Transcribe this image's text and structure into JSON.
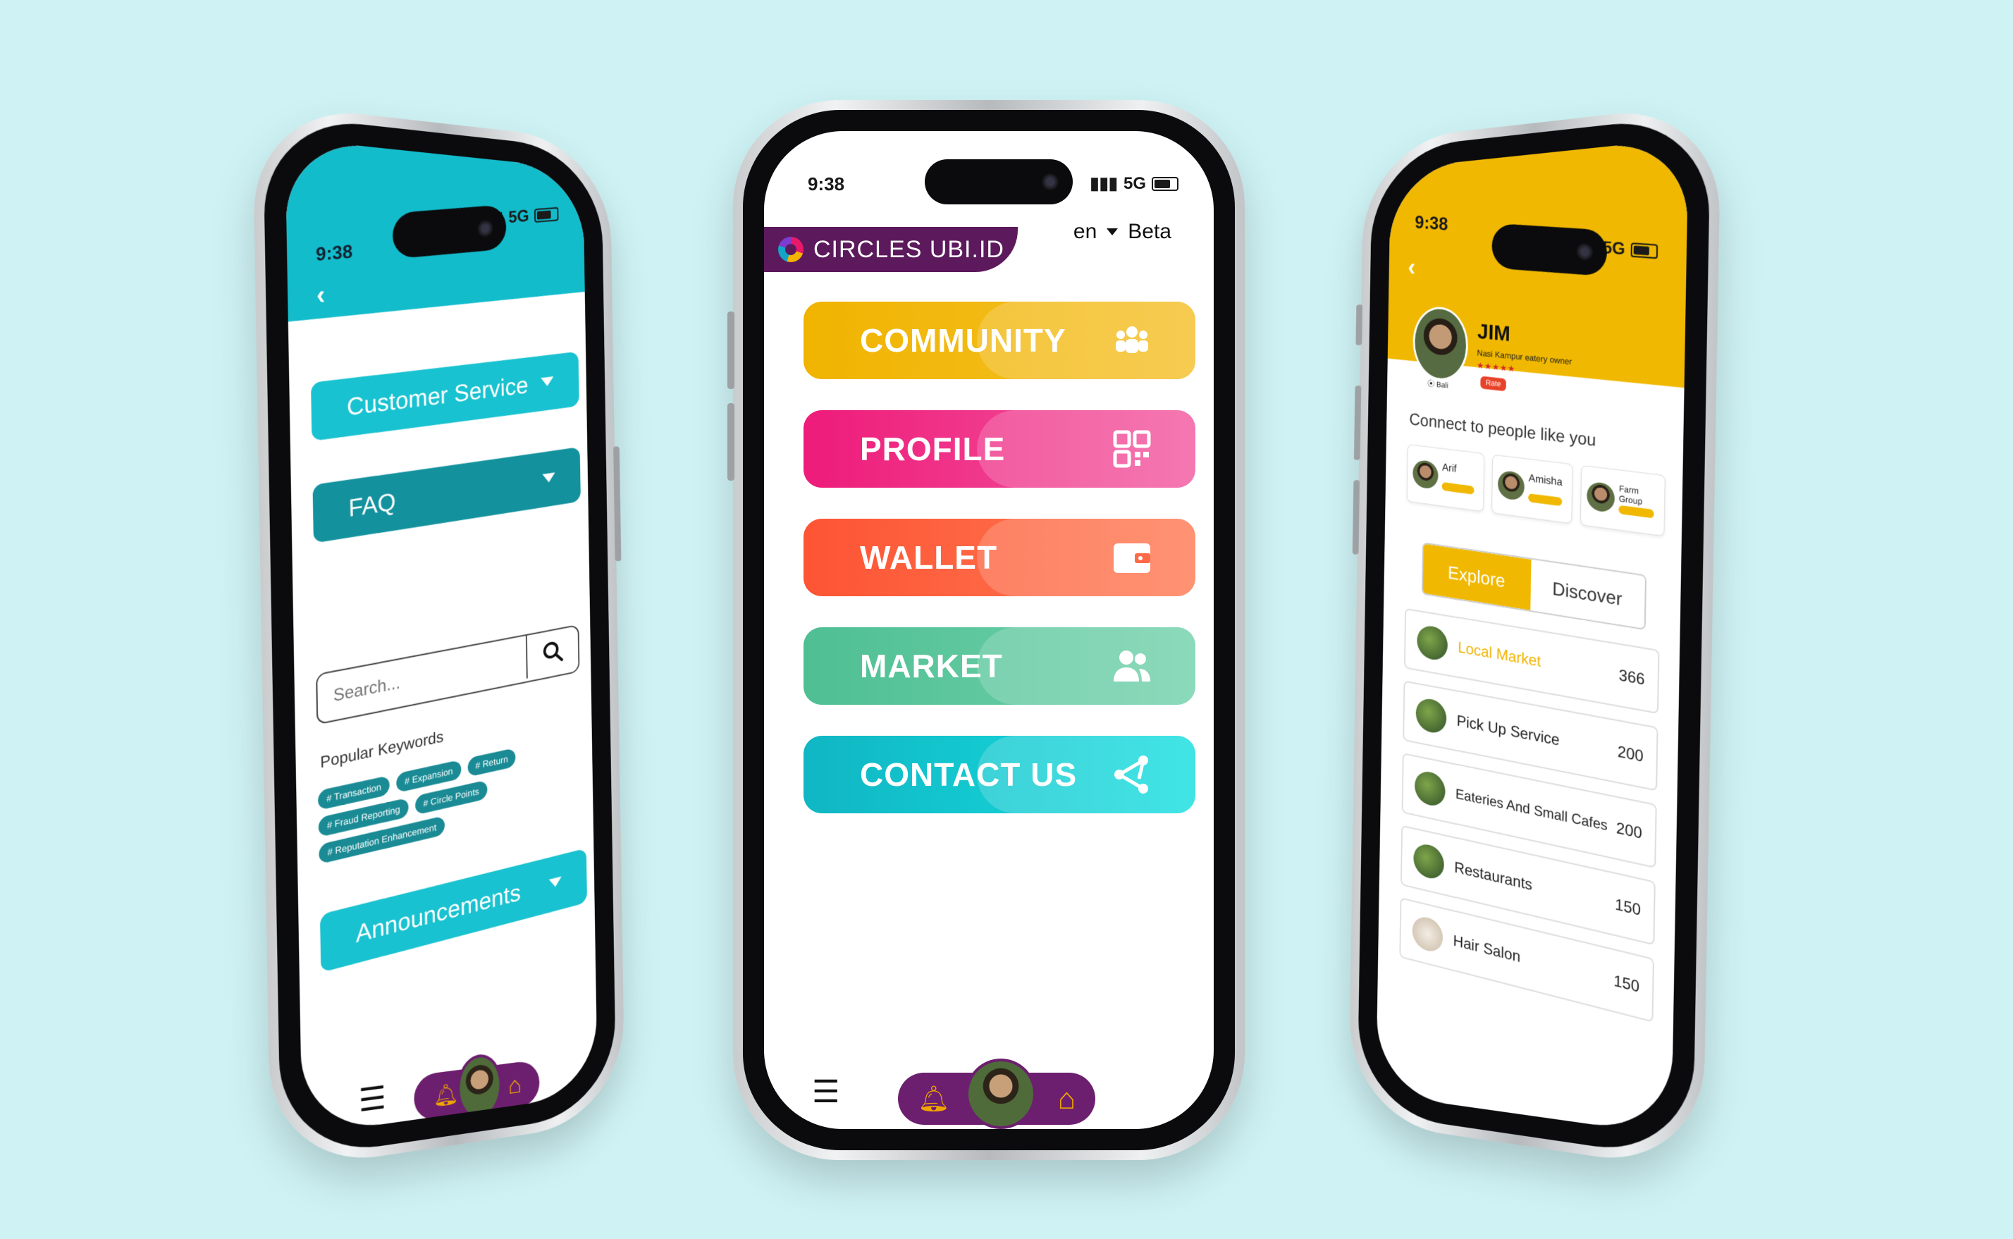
{
  "status": {
    "time": "9:38",
    "network": "5G"
  },
  "center": {
    "brand": "CIRCLES UBI.ID",
    "lang": "en",
    "beta": "Beta",
    "menu": [
      {
        "label": "COMMUNITY",
        "icon": "community-icon",
        "color": "#f0b400"
      },
      {
        "label": "PROFILE",
        "icon": "qr-code-icon",
        "color": "#ee1b7a"
      },
      {
        "label": "WALLET",
        "icon": "wallet-icon",
        "color": "#fd5434"
      },
      {
        "label": "MARKET",
        "icon": "users-icon",
        "color": "#4fbf93"
      },
      {
        "label": "CONTACT US",
        "icon": "share-icon",
        "color": "#10b6c3"
      }
    ]
  },
  "left": {
    "accordions": [
      {
        "label": "Customer Service",
        "color": "#19c2d0"
      },
      {
        "label": "FAQ",
        "color": "#13929e"
      },
      {
        "label": "Announcements",
        "color": "#19c2d0"
      }
    ],
    "search_placeholder": "Search...",
    "keywords_title": "Popular Keywords",
    "keywords": [
      "# Transaction",
      "# Expansion",
      "# Return",
      "# Fraud Reporting",
      "# Circle Points",
      "# Reputation Enhancement"
    ]
  },
  "right": {
    "name": "JIM",
    "role": "Nasi Kampur eatery owner",
    "stars": "★★★★★",
    "rate": "Rate",
    "location": "Bali",
    "connect_title": "Connect to people like you",
    "people": [
      {
        "name": "Arif"
      },
      {
        "name": "Amisha"
      },
      {
        "name": "Farm Group"
      }
    ],
    "tabs": {
      "explore": "Explore",
      "discover": "Discover"
    },
    "categories": [
      {
        "name": "Local Market",
        "count": "366",
        "highlight": true
      },
      {
        "name": "Pick Up Service",
        "count": "200"
      },
      {
        "name": "Eateries And Small Cafes",
        "count": "200"
      },
      {
        "name": "Restaurants",
        "count": "150"
      },
      {
        "name": "Hair Salon",
        "count": "150"
      }
    ]
  }
}
